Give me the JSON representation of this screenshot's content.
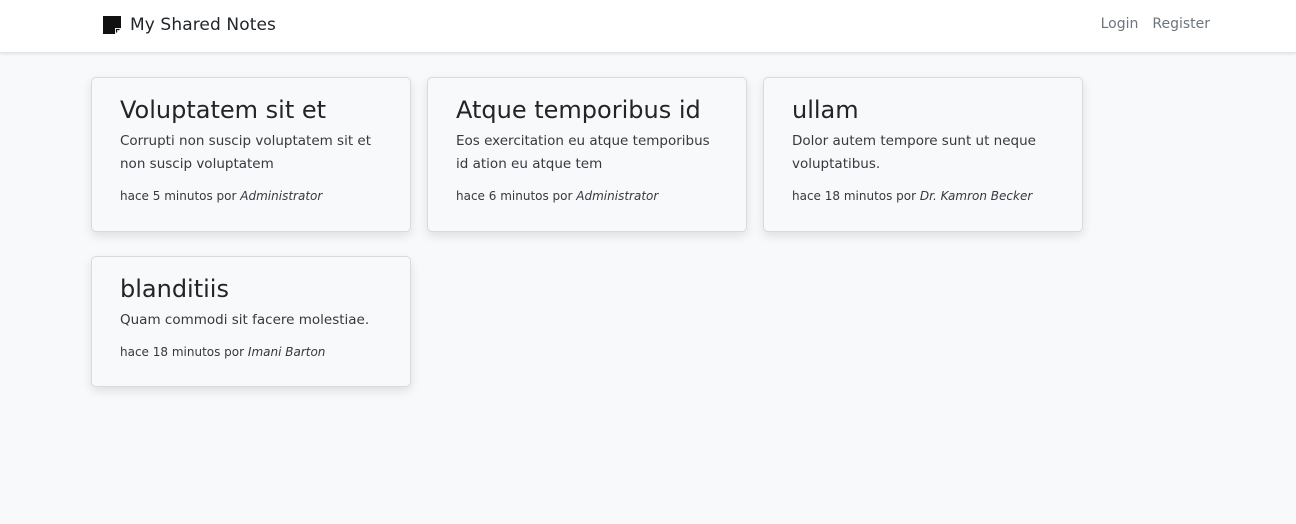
{
  "navbar": {
    "brand": "My Shared Notes",
    "brand_icon": "sticky-note-icon",
    "links": [
      "Login",
      "Register"
    ]
  },
  "notes": [
    {
      "title": "Voluptatem sit et",
      "body": "Corrupti non suscip voluptatem sit et non suscip voluptatem",
      "meta_prefix": "hace 5 minutos por",
      "author": "Administrator"
    },
    {
      "title": "Atque temporibus id",
      "body": "Eos exercitation eu atque temporibus id ation eu atque tem",
      "meta_prefix": "hace 6 minutos por",
      "author": "Administrator"
    },
    {
      "title": "ullam",
      "body": "Dolor autem tempore sunt ut neque voluptatibus.",
      "meta_prefix": "hace 18 minutos por",
      "author": "Dr. Kamron Becker"
    },
    {
      "title": "blanditiis",
      "body": "Quam commodi sit facere molestiae.",
      "meta_prefix": "hace 18 minutos por",
      "author": "Imani Barton"
    }
  ]
}
